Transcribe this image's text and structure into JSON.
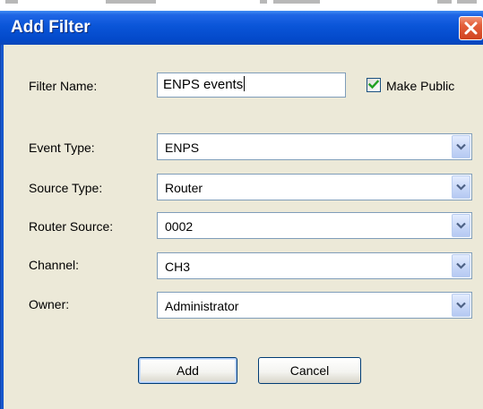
{
  "window": {
    "title": "Add Filter",
    "close_icon": "close-icon"
  },
  "colors": {
    "title_bar": "#0a55d8",
    "close_button": "#e4603c",
    "dialog_background": "#ece9d8",
    "input_border": "#7f9db9",
    "checkmark": "#21a121"
  },
  "filter_name": {
    "label": "Filter Name:",
    "value": "ENPS events"
  },
  "make_public": {
    "label": "Make Public",
    "checked": true
  },
  "fields": [
    {
      "label": "Event Type:",
      "value": "ENPS"
    },
    {
      "label": "Source Type:",
      "value": "Router"
    },
    {
      "label": "Router Source:",
      "value": "0002"
    },
    {
      "label": "Channel:",
      "value": "CH3"
    },
    {
      "label": "Owner:",
      "value": "Administrator"
    }
  ],
  "buttons": {
    "add_label": "Add",
    "cancel_label": "Cancel"
  }
}
